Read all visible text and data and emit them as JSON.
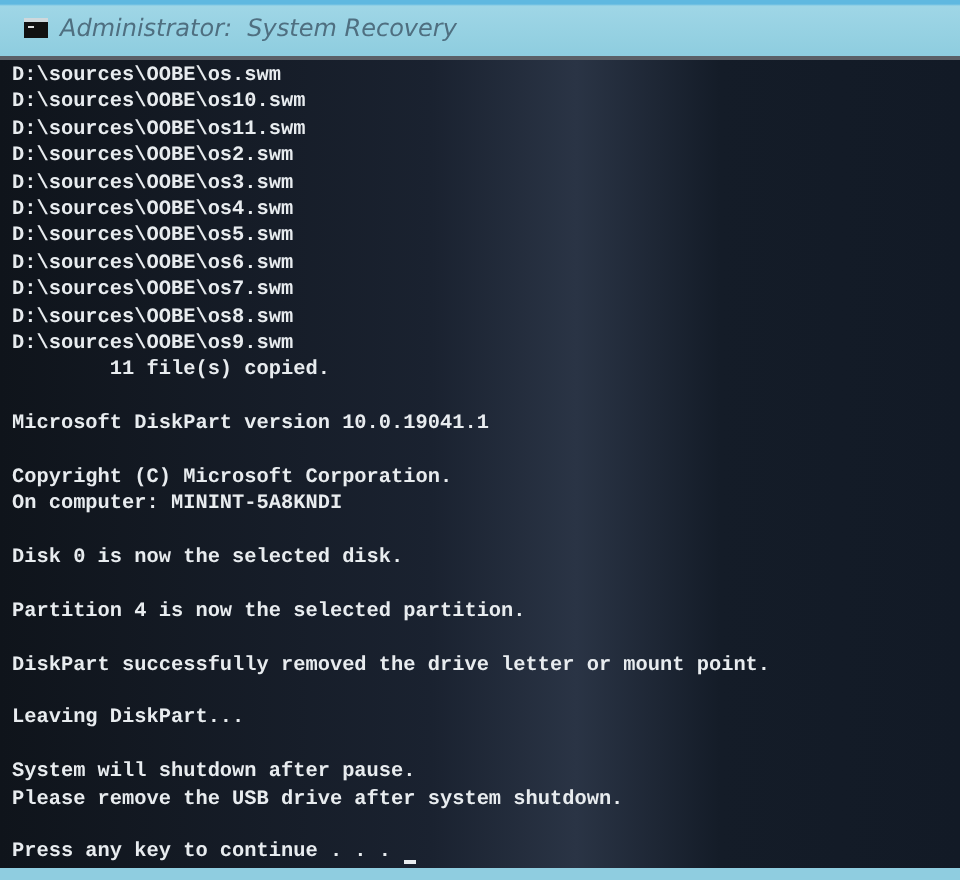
{
  "window": {
    "title": "Administrator:  System Recovery"
  },
  "console": {
    "blocks": [
      [
        "D:\\sources\\OOBE\\os.swm",
        "D:\\sources\\OOBE\\os10.swm",
        "D:\\sources\\OOBE\\os11.swm",
        "D:\\sources\\OOBE\\os2.swm",
        "D:\\sources\\OOBE\\os3.swm",
        "D:\\sources\\OOBE\\os4.swm",
        "D:\\sources\\OOBE\\os5.swm",
        "D:\\sources\\OOBE\\os6.swm",
        "D:\\sources\\OOBE\\os7.swm",
        "D:\\sources\\OOBE\\os8.swm",
        "D:\\sources\\OOBE\\os9.swm",
        "        11 file(s) copied."
      ],
      [
        "Microsoft DiskPart version 10.0.19041.1"
      ],
      [
        "Copyright (C) Microsoft Corporation.",
        "On computer: MININT-5A8KNDI"
      ],
      [
        "Disk 0 is now the selected disk."
      ],
      [
        "Partition 4 is now the selected partition."
      ],
      [
        "DiskPart successfully removed the drive letter or mount point."
      ],
      [
        "Leaving DiskPart..."
      ],
      [
        "System will shutdown after pause.",
        "Please remove the USB drive after system shutdown."
      ],
      [
        "Press any key to continue . . . "
      ]
    ]
  }
}
